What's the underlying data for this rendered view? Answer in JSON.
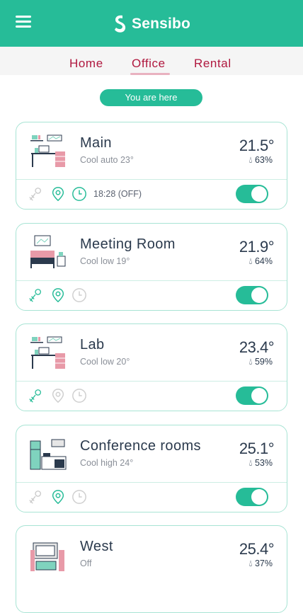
{
  "app": {
    "name": "Sensibo"
  },
  "tabs": [
    {
      "label": "Home"
    },
    {
      "label": "Office"
    },
    {
      "label": "Rental"
    }
  ],
  "location_badge": "You are here",
  "rooms": [
    {
      "name": "Main",
      "mode": "Cool auto 23°",
      "temp": "21.5°",
      "humidity": "63%",
      "timer_text": "18:28 (OFF)",
      "power_on": true
    },
    {
      "name": "Meeting Room",
      "mode": "Cool low 19°",
      "temp": "21.9°",
      "humidity": "64%",
      "power_on": true
    },
    {
      "name": "Lab",
      "mode": "Cool low 20°",
      "temp": "23.4°",
      "humidity": "59%",
      "power_on": true
    },
    {
      "name": "Conference rooms",
      "mode": "Cool high 24°",
      "temp": "25.1°",
      "humidity": "53%",
      "power_on": true
    },
    {
      "name": "West",
      "mode": "Off",
      "temp": "25.4°",
      "humidity": "37%"
    }
  ],
  "colors": {
    "brand": "#26bc98",
    "tab_text": "#b0183f",
    "card_border": "#a8e4d4"
  }
}
